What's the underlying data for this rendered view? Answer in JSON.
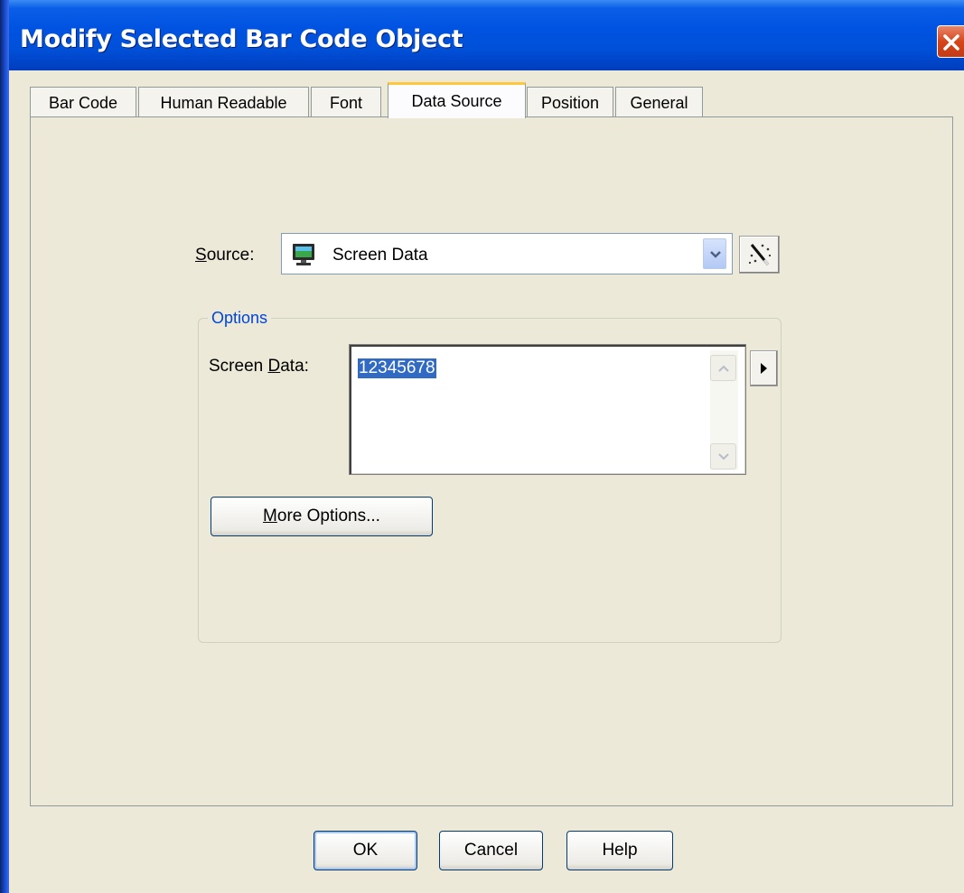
{
  "window": {
    "title": "Modify Selected Bar Code Object"
  },
  "tabs": [
    {
      "label": "Bar Code",
      "active": false
    },
    {
      "label": "Human Readable",
      "active": false
    },
    {
      "label": "Font",
      "active": false
    },
    {
      "label": "Data Source",
      "active": true
    },
    {
      "label": "Position",
      "active": false
    },
    {
      "label": "General",
      "active": false
    }
  ],
  "source": {
    "label_prefix": "",
    "label_access": "S",
    "label_rest": "ource:",
    "value": "Screen Data",
    "icon": "monitor-icon"
  },
  "options": {
    "legend": "Options",
    "screen_data_label_pre": "Screen ",
    "screen_data_label_access": "D",
    "screen_data_label_post": "ata:",
    "screen_data_value": "12345678",
    "more_options_access": "M",
    "more_options_rest": "ore Options..."
  },
  "buttons": {
    "ok": "OK",
    "cancel": "Cancel",
    "help": "Help"
  },
  "colors": {
    "title_bar": "#0053e1",
    "selection": "#316ac5",
    "legend": "#0046d5",
    "active_tab_accent": "#ffc83c"
  }
}
